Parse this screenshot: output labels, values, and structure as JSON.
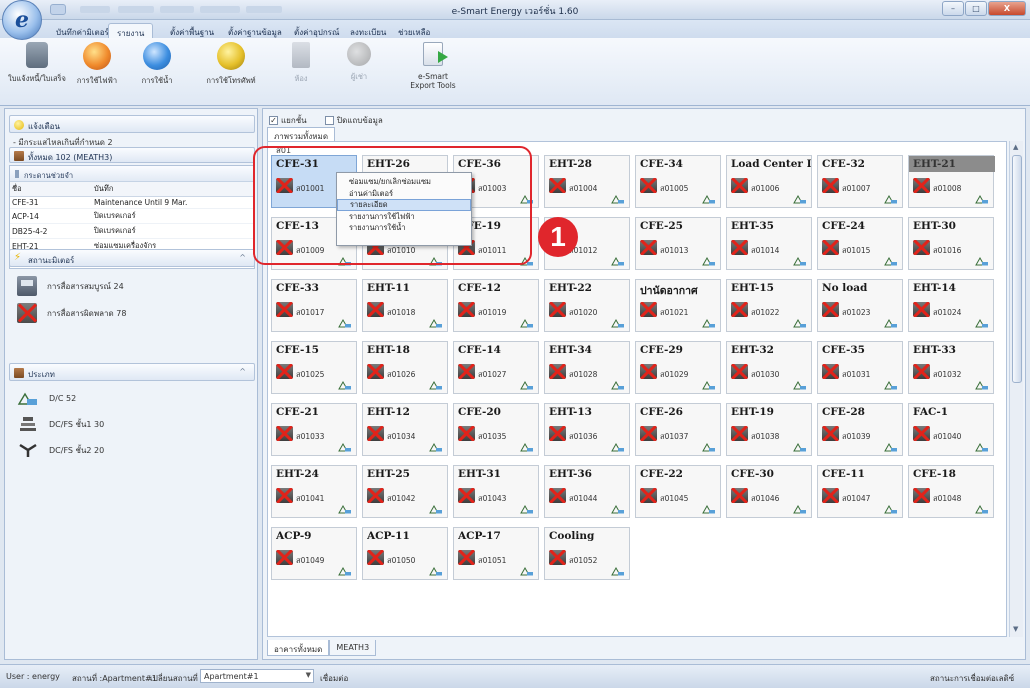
{
  "window": {
    "title": "e-Smart Energy เวอร์ชั่น 1.60",
    "controls": {
      "minimize": "–",
      "maximize": "□",
      "close": "X"
    }
  },
  "menu_tabs": [
    "บันทึกค่ามิเตอร์",
    "รายงาน",
    "ตั้งค่าพื้นฐาน",
    "ตั้งค่าฐานข้อมูล",
    "ตั้งค่าอุปกรณ์",
    "ลงทะเบียน",
    "ช่วยเหลือ"
  ],
  "active_tab_index": 1,
  "ribbon": [
    {
      "label": "ใบแจ้งหนี้/ใบเสร็จ",
      "icon": "database-icon",
      "cls": "db",
      "enabled": true
    },
    {
      "label": "การใช้ไฟฟ้า",
      "icon": "electricity-icon",
      "cls": "elec",
      "enabled": true
    },
    {
      "label": "การใช้น้ำ",
      "icon": "water-icon",
      "cls": "water",
      "enabled": true
    },
    {
      "label": "การใช้โทรศัพท์",
      "icon": "phone-icon",
      "cls": "phone",
      "enabled": true
    },
    {
      "label": "ห้อง",
      "icon": "room-icon",
      "cls": "room",
      "enabled": false
    },
    {
      "label": "ผู้เช่า",
      "icon": "users-icon",
      "cls": "users",
      "enabled": false
    },
    {
      "label": "e-Smart\nExport Tools",
      "icon": "export-icon",
      "cls": "export",
      "enabled": true
    }
  ],
  "left": {
    "alert_header": "แจ้งเตือน",
    "alert_text": "- มีกระแสไหลเกินที่กำหนด 2",
    "group_label": "ทั้งหมด 102 (MEATH3)",
    "memo": {
      "caption": "กระดานช่วยจำ",
      "headers": [
        "ชื่อ",
        "บันทึก"
      ],
      "rows": [
        [
          "CFE-31",
          "Maintenance Until 9 Mar."
        ],
        [
          "ACP-14",
          "ปิดเบรคเกอร์"
        ],
        [
          "DB25-4-2",
          "ปิดเบรคเกอร์"
        ],
        [
          "EHT-21",
          "ซ่อมแซมเครื่องจักร"
        ]
      ]
    },
    "meter_status_header": "สถานะมิเตอร์",
    "meter_status": [
      {
        "label": "การสื่อสารสมบูรณ์ 24",
        "icon": "meter-icon",
        "cls": "meter"
      },
      {
        "label": "การสื่อสารผิดพลาด 78",
        "icon": "comm-error-icon",
        "cls": "off"
      }
    ],
    "type_header": "ประเภท",
    "types": [
      {
        "label": "D/C 52",
        "icon": "dc-meter-icon"
      },
      {
        "label": "DC/FS ชั้น1 30",
        "icon": "dcfs1-icon"
      },
      {
        "label": "DC/FS ชั้น2 20",
        "icon": "dcfs2-icon"
      }
    ]
  },
  "main": {
    "checkbox_group": {
      "label": "แยกชั้น",
      "checked": true
    },
    "checkbox_hide": {
      "label": "ปิดแถบข้อมูล",
      "checked": false
    },
    "view_tab": "ภาพรวมทั้งหมด",
    "grid_label": "ส01",
    "cards": [
      {
        "name": "CFE-31",
        "code": "ส01001",
        "state": "selected"
      },
      {
        "name": "EHT-26",
        "code": "ส01002"
      },
      {
        "name": "CFE-36",
        "code": "ส01003"
      },
      {
        "name": "EHT-28",
        "code": "ส01004"
      },
      {
        "name": "CFE-34",
        "code": "ส01005"
      },
      {
        "name": "Load Center D/C",
        "code": "ส01006"
      },
      {
        "name": "CFE-32",
        "code": "ส01007"
      },
      {
        "name": "EHT-21",
        "code": "ส01008",
        "state": "gray"
      },
      {
        "name": "CFE-13",
        "code": "ส01009"
      },
      {
        "name": "",
        "code": "ส01010"
      },
      {
        "name": "CFE-19",
        "code": "ส01011"
      },
      {
        "name": "",
        "code": "ส01012"
      },
      {
        "name": "CFE-25",
        "code": "ส01013"
      },
      {
        "name": "EHT-35",
        "code": "ส01014"
      },
      {
        "name": "CFE-24",
        "code": "ส01015"
      },
      {
        "name": "EHT-30",
        "code": "ส01016"
      },
      {
        "name": "CFE-33",
        "code": "ส01017"
      },
      {
        "name": "EHT-11",
        "code": "ส01018"
      },
      {
        "name": "CFE-12",
        "code": "ส01019"
      },
      {
        "name": "EHT-22",
        "code": "ส01020"
      },
      {
        "name": "ปานัดอากาศ",
        "code": "ส01021"
      },
      {
        "name": "EHT-15",
        "code": "ส01022"
      },
      {
        "name": "No load",
        "code": "ส01023"
      },
      {
        "name": "EHT-14",
        "code": "ส01024"
      },
      {
        "name": "CFE-15",
        "code": "ส01025"
      },
      {
        "name": "EHT-18",
        "code": "ส01026"
      },
      {
        "name": "CFE-14",
        "code": "ส01027"
      },
      {
        "name": "EHT-34",
        "code": "ส01028"
      },
      {
        "name": "CFE-29",
        "code": "ส01029"
      },
      {
        "name": "EHT-32",
        "code": "ส01030"
      },
      {
        "name": "CFE-35",
        "code": "ส01031"
      },
      {
        "name": "EHT-33",
        "code": "ส01032"
      },
      {
        "name": "CFE-21",
        "code": "ส01033"
      },
      {
        "name": "EHT-12",
        "code": "ส01034"
      },
      {
        "name": "CFE-20",
        "code": "ส01035"
      },
      {
        "name": "EHT-13",
        "code": "ส01036"
      },
      {
        "name": "CFE-26",
        "code": "ส01037"
      },
      {
        "name": "EHT-19",
        "code": "ส01038"
      },
      {
        "name": "CFE-28",
        "code": "ส01039"
      },
      {
        "name": "FAC-1",
        "code": "ส01040"
      },
      {
        "name": "EHT-24",
        "code": "ส01041"
      },
      {
        "name": "EHT-25",
        "code": "ส01042"
      },
      {
        "name": "EHT-31",
        "code": "ส01043"
      },
      {
        "name": "EHT-36",
        "code": "ส01044"
      },
      {
        "name": "CFE-22",
        "code": "ส01045"
      },
      {
        "name": "CFE-30",
        "code": "ส01046"
      },
      {
        "name": "CFE-11",
        "code": "ส01047"
      },
      {
        "name": "CFE-18",
        "code": "ส01048"
      },
      {
        "name": "ACP-9",
        "code": "ส01049"
      },
      {
        "name": "ACP-11",
        "code": "ส01050"
      },
      {
        "name": "ACP-17",
        "code": "ส01051"
      },
      {
        "name": "Cooling",
        "code": "ส01052"
      }
    ],
    "context_menu": [
      "ซ่อมแซม/ยกเลิกซ่อมแซม",
      "อ่านค่ามิเตอร์",
      "รายละเอียด",
      "รายงานการใช้ไฟฟ้า",
      "รายงานการใช้น้ำ"
    ],
    "context_menu_hover_index": 2,
    "bottom_tabs": [
      "อาคารทั้งหมด",
      "MEATH3"
    ],
    "callout_number": "1"
  },
  "statusbar": {
    "user": "User : energy",
    "site": "สถานที่ :Apartment#1",
    "change_site_label": "เปลี่ยนสถานที่ :",
    "site_value": "Apartment#1",
    "connect": "เชื่อมต่อ",
    "conn_status": "สถานะการเชื่อมต่อเลดิซ์"
  }
}
